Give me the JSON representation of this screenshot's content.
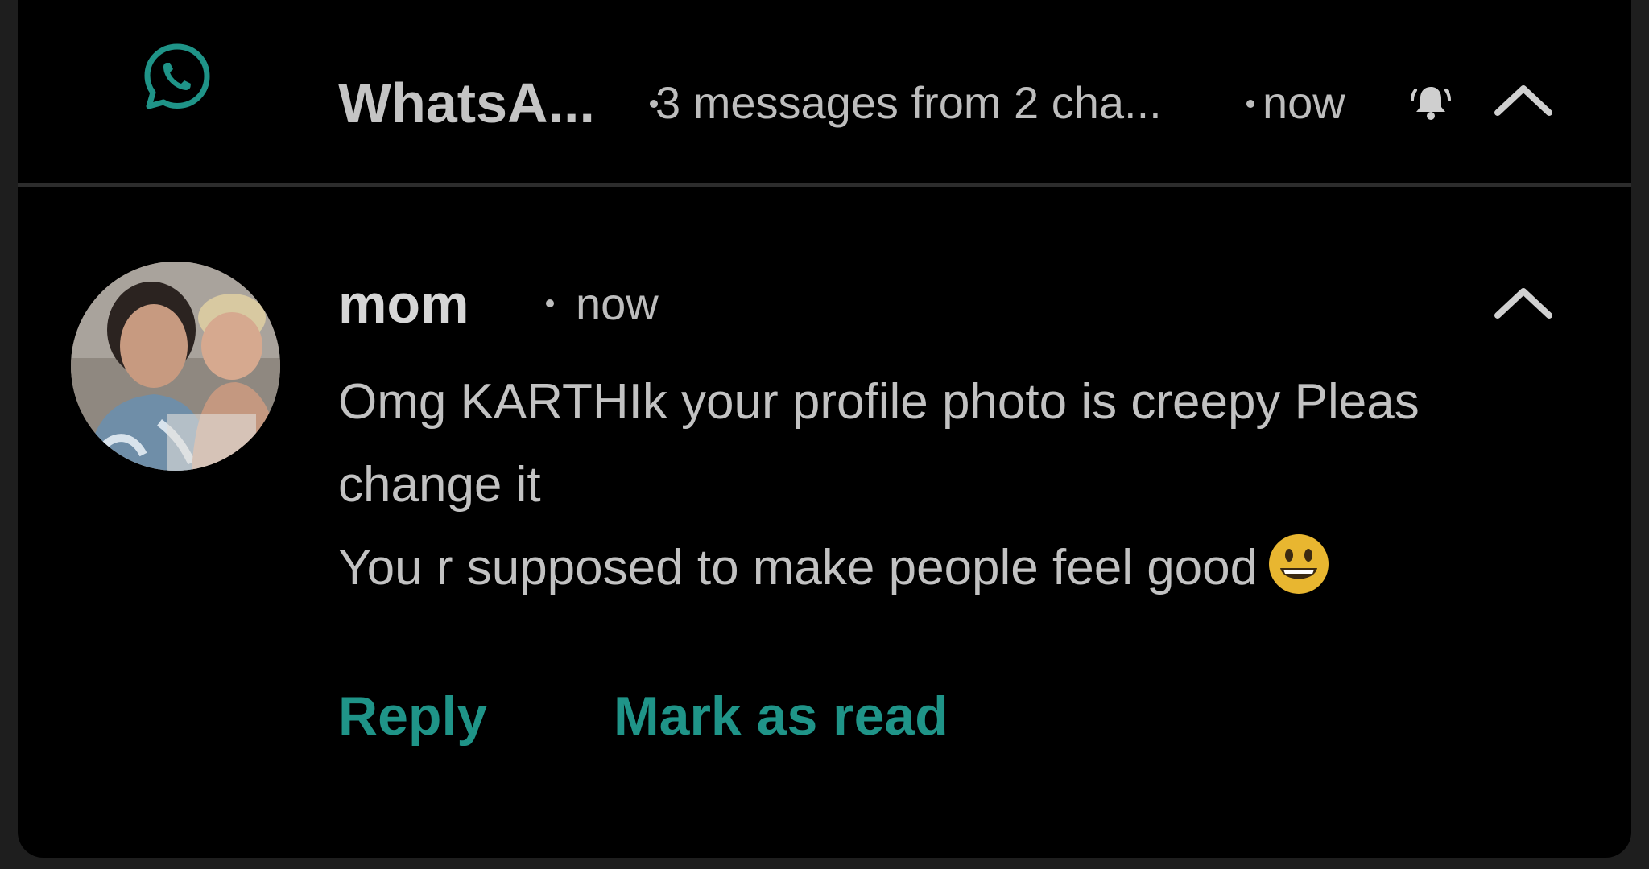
{
  "notification_group": {
    "app_icon": "whatsapp-icon",
    "app_name": "WhatsA...",
    "summary": "3 messages from 2 cha...",
    "time": "now",
    "bell_icon": "bell-alert-icon",
    "collapse_icon": "chevron-up-icon"
  },
  "message": {
    "avatar": "contact-photo",
    "sender": "mom",
    "time": "now",
    "lines": [
      "Omg KARTHIk your profile photo is creepy Pleas",
      "change it",
      "You r supposed to make people feel good"
    ],
    "emoji": "grinning-face-emoji",
    "collapse_icon": "chevron-up-icon"
  },
  "actions": {
    "reply": "Reply",
    "mark_as_read": "Mark as read"
  },
  "colors": {
    "background": "#000000",
    "accent": "#1f9488",
    "text_primary": "#d6d6d6",
    "text_secondary": "#bdbdbd"
  }
}
